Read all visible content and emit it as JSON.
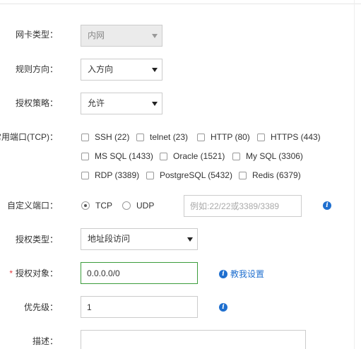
{
  "form": {
    "nic_type": {
      "label": "网卡类型：",
      "value": "内网"
    },
    "direction": {
      "label": "规则方向：",
      "value": "入方向"
    },
    "policy": {
      "label": "授权策略：",
      "value": "允许"
    },
    "common_ports": {
      "label": "常用端口(TCP)：",
      "options": [
        {
          "label": "SSH (22)",
          "checked": false
        },
        {
          "label": "telnet (23)",
          "checked": false
        },
        {
          "label": "HTTP (80)",
          "checked": false
        },
        {
          "label": "HTTPS (443)",
          "checked": false
        },
        {
          "label": "MS SQL (1433)",
          "checked": false
        },
        {
          "label": "Oracle (1521)",
          "checked": false
        },
        {
          "label": "My SQL (3306)",
          "checked": false
        },
        {
          "label": "RDP (3389)",
          "checked": false
        },
        {
          "label": "PostgreSQL (5432)",
          "checked": false
        },
        {
          "label": "Redis (6379)",
          "checked": false
        }
      ]
    },
    "custom_port": {
      "label": "自定义端口：",
      "protocols": [
        {
          "label": "TCP",
          "selected": true
        },
        {
          "label": "UDP",
          "selected": false
        }
      ],
      "placeholder": "例如:22/22或3389/3389",
      "value": ""
    },
    "auth_type": {
      "label": "授权类型：",
      "value": "地址段访问"
    },
    "auth_object": {
      "required_mark": "*",
      "label": "授权对象：",
      "value": "0.0.0.0/0",
      "help_text": "教我设置"
    },
    "priority": {
      "label": "优先级：",
      "value": "1"
    },
    "description": {
      "label": "描述：",
      "value": ""
    }
  },
  "colors": {
    "link": "#1f6fcf",
    "valid_border": "#3c9d3c",
    "required": "#e4393c"
  }
}
